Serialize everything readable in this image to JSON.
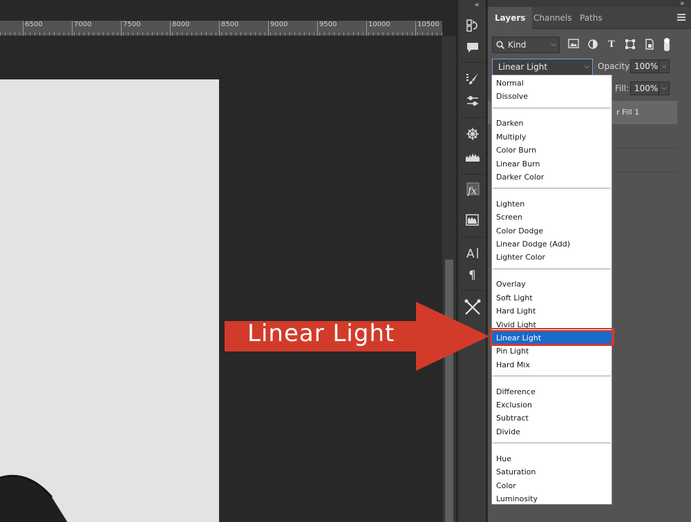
{
  "ruler": {
    "ticks": [
      "6500",
      "7000",
      "7500",
      "8000",
      "8500",
      "9000",
      "9500",
      "10000",
      "10500"
    ]
  },
  "panel": {
    "tabs": [
      "Layers",
      "Channels",
      "Paths"
    ],
    "kind_filter": "Kind",
    "blend_mode": "Linear Light",
    "opacity_label": "Opacity:",
    "opacity_value": "100%",
    "fill_label": "Fill:",
    "fill_value": "100%",
    "layer_name": "r Fill 1"
  },
  "dropdown": {
    "groups": [
      [
        "Normal",
        "Dissolve"
      ],
      [
        "Darken",
        "Multiply",
        "Color Burn",
        "Linear Burn",
        "Darker Color"
      ],
      [
        "Lighten",
        "Screen",
        "Color Dodge",
        "Linear Dodge (Add)",
        "Lighter Color"
      ],
      [
        "Overlay",
        "Soft Light",
        "Hard Light",
        "Vivid Light",
        "Linear Light",
        "Pin Light",
        "Hard Mix"
      ],
      [
        "Difference",
        "Exclusion",
        "Subtract",
        "Divide"
      ],
      [
        "Hue",
        "Saturation",
        "Color",
        "Luminosity"
      ]
    ],
    "selected": "Linear Light"
  },
  "annotation": {
    "label": "Linear Light",
    "color": "#d23b2a"
  },
  "colors": {
    "selection_blue": "#1b6ac9",
    "panel_bg": "#535353",
    "canvas_bg": "#282828"
  },
  "icons": {
    "collapse_left": "double-chevron-left-icon",
    "collapse_right": "double-chevron-right-icon",
    "tools": [
      "history-icon",
      "comment-icon",
      "brush-settings-icon",
      "adjustment-sliders-icon",
      "navigator-wheel-icon",
      "histogram-icon",
      "fx-styles-icon",
      "libraries-icon",
      "character-icon",
      "paragraph-icon",
      "tools-cross-icon"
    ]
  }
}
